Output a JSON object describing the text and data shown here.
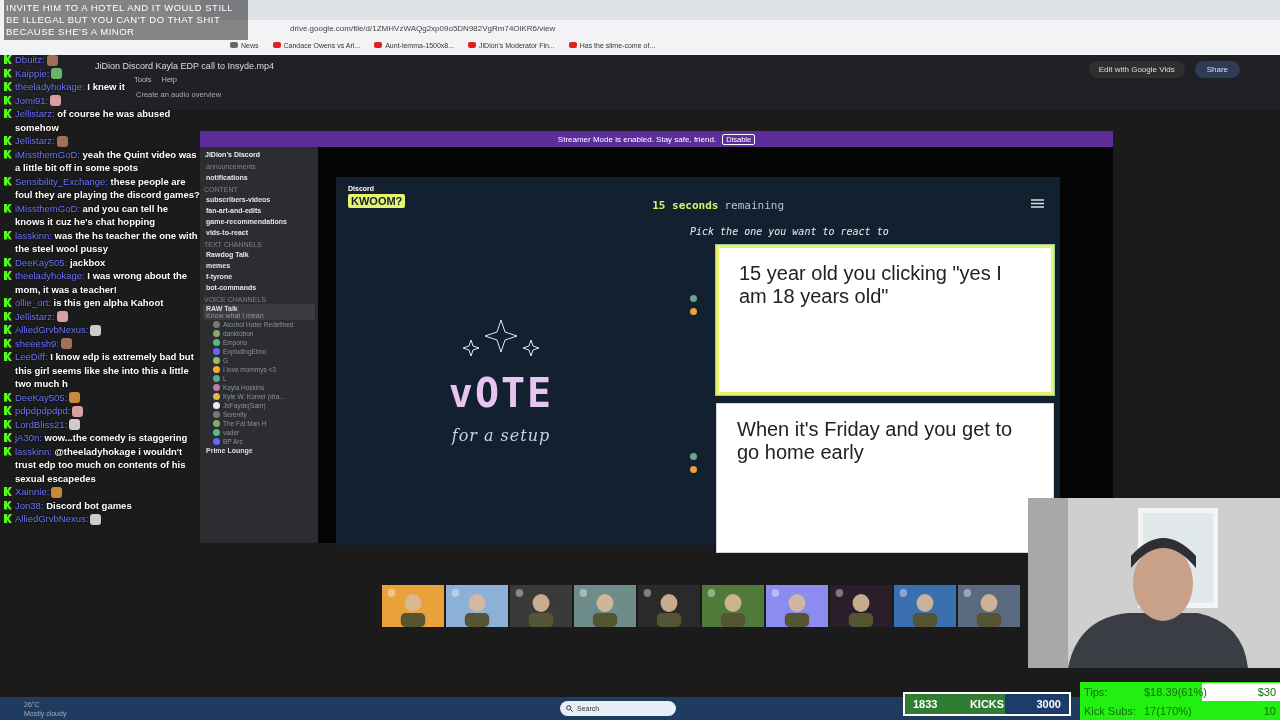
{
  "browser": {
    "address": "drive.google.com/file/d/1ZMHVzWAQg2xp09o5DN982VgRm74OiKR6/view",
    "bookmarks": [
      "News",
      "Candace Owens vs Ari...",
      "Aunt-lemma-1500x8...",
      "JiDion's Moderator Fin...",
      "Has the slime-come of..."
    ],
    "file_title": "JiDion Discord Kayla EDP call to Insyde.mp4",
    "menu": [
      "Tools",
      "Help"
    ],
    "audio_overview": "Create an audio overview",
    "edit_button": "Edit with Google Vids",
    "share_button": "Share"
  },
  "caption": "INVITE HIM TO A HOTEL AND IT WOULD STILL BE ILLEGAL BUT YOU CAN'T DO THAT SHIT BECAUSE SHE'S A MINOR",
  "chat": [
    {
      "user": "Dbuitz:",
      "emote": true
    },
    {
      "user": "Kaippie:",
      "emote": true
    },
    {
      "user": "theeladyhokage:",
      "text": "I knew it",
      "emote": false
    },
    {
      "user": "Jomi91:",
      "emote": true
    },
    {
      "user": "Jellistarz:",
      "text": "of course he was abused somehow",
      "emote": false
    },
    {
      "user": "Jellistarz:",
      "emote": true
    },
    {
      "user": "iMissthemGoD:",
      "text": "yeah the Quint video was a little bit off in some spots",
      "emote": false
    },
    {
      "user": "Sensibility_Exchange:",
      "text": "these people are foul they are playing the discord games?",
      "emote": false
    },
    {
      "user": "iMissthemGoD:",
      "text": "and you can tell he knows it cuz he's chat hopping",
      "emote": false
    },
    {
      "user": "lasskinn:",
      "text": "was the hs teacher the one with the steel wool pussy",
      "emote": false
    },
    {
      "user": "DeeKay505:",
      "text": "jackbox",
      "emote": false
    },
    {
      "user": "theeladyhokage:",
      "text": "I was wrong about the mom, it was a teacher!",
      "emote": false
    },
    {
      "user": "ollie_ort:",
      "text": "is this gen alpha Kahoot",
      "emote": false
    },
    {
      "user": "Jellistarz:",
      "emote": true
    },
    {
      "user": "AlliedGrvbNexus:",
      "emote": true
    },
    {
      "user": "sheeesh9:",
      "emote": true
    },
    {
      "user": "LeeDiff:",
      "text": "I know edp is extremely bad but this girl seems like she into this a little two much h",
      "emote": false
    },
    {
      "user": "DeeKay505:",
      "emote": true
    },
    {
      "user": "pdpdpdpdpd:",
      "emote": true
    },
    {
      "user": "LordBliss21:",
      "emote": true
    },
    {
      "user": "jA30n:",
      "text": "wow...the comedy is staggering",
      "emote": false
    },
    {
      "user": "lasskinn:",
      "text": "@theeladyhokage i wouldn't trust edp too much on contents of his sexual escapedes",
      "emote": false
    },
    {
      "user": "Xainnie:",
      "emote": true
    },
    {
      "user": "Jon38:",
      "text": "Discord bot games",
      "emote": false
    },
    {
      "user": "AlliedGrvbNexus:",
      "emote": true
    }
  ],
  "streamer_banner": {
    "text": "Streamer Mode is enabled. Stay safe, friend.",
    "button": "Disable"
  },
  "discord": {
    "server": "JiDion's Discord",
    "channels": [
      {
        "kind": "channel",
        "name": "announcements",
        "bold": false
      },
      {
        "kind": "channel",
        "name": "notifications",
        "bold": true
      },
      {
        "kind": "category",
        "name": "CONTENT"
      },
      {
        "kind": "channel",
        "name": "subscribers-videos",
        "bold": true
      },
      {
        "kind": "channel",
        "name": "fan-art-and-edits",
        "bold": true
      },
      {
        "kind": "channel",
        "name": "game-recommendations",
        "bold": true
      },
      {
        "kind": "channel",
        "name": "vids-to-react",
        "bold": true
      },
      {
        "kind": "category",
        "name": "TEXT CHANNELS"
      },
      {
        "kind": "channel",
        "name": "Rawdog Talk",
        "bold": true
      },
      {
        "kind": "channel",
        "name": "memes",
        "bold": true
      },
      {
        "kind": "channel",
        "name": "f-tyrone",
        "bold": true
      },
      {
        "kind": "channel",
        "name": "bot-commands",
        "bold": true
      },
      {
        "kind": "category",
        "name": "VOICE CHANNELS"
      },
      {
        "kind": "voice",
        "name": "RAW Talk",
        "status": "Know what I mean",
        "selected": true
      },
      {
        "kind": "user",
        "name": "Alcohol Hater Redefined"
      },
      {
        "kind": "user",
        "name": "danktobon"
      },
      {
        "kind": "user",
        "name": "Emporio"
      },
      {
        "kind": "user",
        "name": "ExplodingElmo"
      },
      {
        "kind": "user",
        "name": "G"
      },
      {
        "kind": "user",
        "name": "I love mommys <3"
      },
      {
        "kind": "user",
        "name": "L"
      },
      {
        "kind": "user",
        "name": "Kayla Hoskins"
      },
      {
        "kind": "user",
        "name": "Kyle W. Korver (dra..."
      },
      {
        "kind": "user",
        "name": "JeFayde(Sam)"
      },
      {
        "kind": "user",
        "name": "Serenity"
      },
      {
        "kind": "user",
        "name": "The Fat Man H"
      },
      {
        "kind": "user",
        "name": "vader"
      },
      {
        "kind": "user",
        "name": "BP Arc"
      },
      {
        "kind": "voice",
        "name": "Prime Lounge",
        "selected": false
      }
    ]
  },
  "game": {
    "brand": "Discord",
    "logo": "KWOOM?",
    "timer": "15 seconds",
    "timer_suffix": "remaining",
    "prompt": "Pick the one you want to react to",
    "vote_title": "vOTE",
    "vote_subtitle": "for a setup",
    "options": [
      {
        "text": "15 year old you clicking \"yes I am 18 years old\"",
        "selected": true
      },
      {
        "text": "When it's Friday and you get to go home early",
        "selected": false
      }
    ]
  },
  "taskbar": {
    "temperature": "26°C",
    "weather": "Mostly cloudy",
    "search": "Search"
  },
  "kicks": {
    "current": "1833",
    "label": "KICKS",
    "goal": "3000",
    "level": 0.61
  },
  "goals": [
    {
      "label": "Tips:",
      "value": "$18.39(61%)",
      "target": "$30",
      "level": 0.61
    },
    {
      "label": "Kick Subs:",
      "value": "17(170%)",
      "target": "10",
      "level": 1
    }
  ]
}
